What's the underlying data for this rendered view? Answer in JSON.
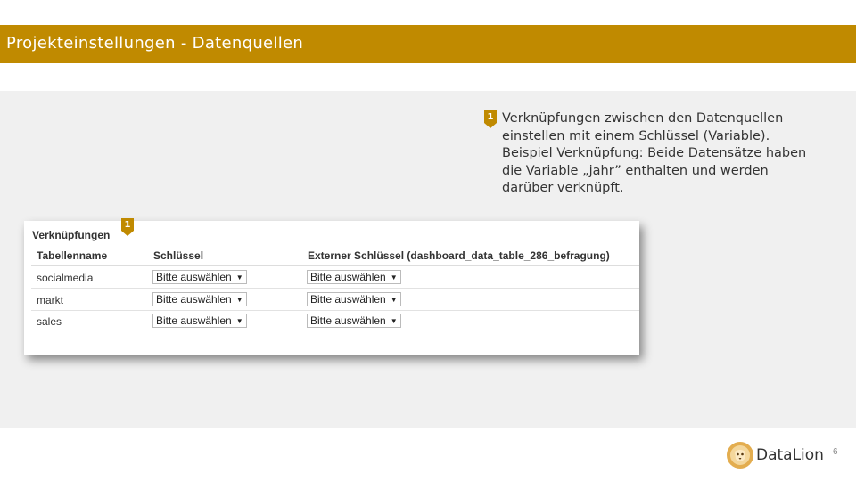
{
  "slide": {
    "title": "Projekteinstellungen - Datenquellen",
    "page_number": "6"
  },
  "colors": {
    "accent": "#c08a00",
    "content_bg": "#f0f0f0"
  },
  "annotation": {
    "badge": "1",
    "lines": [
      "Verknüpfungen zwischen den Datenquellen",
      "einstellen mit einem Schlüssel (Variable).",
      "Beispiel Verknüpfung: Beide Datensätze haben",
      "die Variable „jahr” enthalten und werden",
      "darüber verknüpft."
    ]
  },
  "panel": {
    "badge": "1",
    "title": "Verknüpfungen",
    "columns": [
      "Tabellenname",
      "Schlüssel",
      "Externer Schlüssel (dashboard_data_table_286_befragung)"
    ],
    "rows": [
      {
        "name": "socialmedia",
        "key": "Bitte auswählen",
        "external_key": "Bitte auswählen"
      },
      {
        "name": "markt",
        "key": "Bitte auswählen",
        "external_key": "Bitte auswählen"
      },
      {
        "name": "sales",
        "key": "Bitte auswählen",
        "external_key": "Bitte auswählen"
      }
    ],
    "select_icon": "triangle-down-icon"
  },
  "brand": {
    "name": "DataLion",
    "logo_icon": "lion-logo-icon"
  }
}
